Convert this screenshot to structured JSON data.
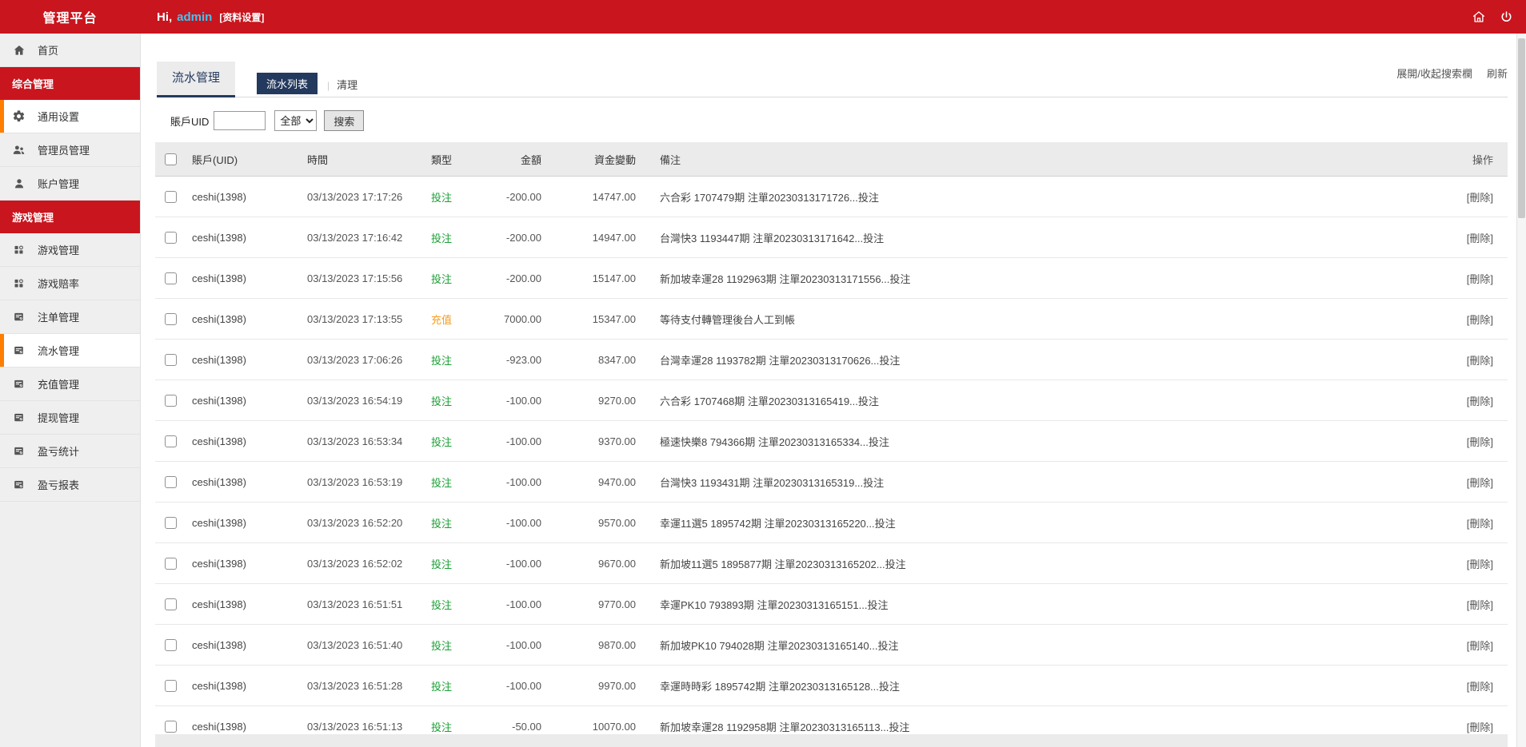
{
  "app": {
    "title": "管理平台"
  },
  "header": {
    "greeting_prefix": "Hi,",
    "greeting_name": "admin",
    "profile_link": "[资料设置]"
  },
  "sidebar": {
    "items": [
      {
        "type": "item",
        "label": "首页",
        "icon": "home",
        "active": false
      },
      {
        "type": "section",
        "label": "综合管理"
      },
      {
        "type": "item",
        "label": "通用设置",
        "icon": "gear",
        "active": true
      },
      {
        "type": "item",
        "label": "管理员管理",
        "icon": "users",
        "active": false
      },
      {
        "type": "item",
        "label": "账户管理",
        "icon": "user",
        "active": false
      },
      {
        "type": "section",
        "label": "游戏管理"
      },
      {
        "type": "item",
        "label": "游戏管理",
        "icon": "apps",
        "active": false
      },
      {
        "type": "item",
        "label": "游戏赔率",
        "icon": "apps",
        "active": false
      },
      {
        "type": "item",
        "label": "注单管理",
        "icon": "doc",
        "active": false
      },
      {
        "type": "item",
        "label": "流水管理",
        "icon": "doc",
        "active": true
      },
      {
        "type": "item",
        "label": "充值管理",
        "icon": "doc",
        "active": false
      },
      {
        "type": "item",
        "label": "提现管理",
        "icon": "doc",
        "active": false
      },
      {
        "type": "item",
        "label": "盈亏统计",
        "icon": "doc",
        "active": false
      },
      {
        "type": "item",
        "label": "盈亏报表",
        "icon": "doc",
        "active": false
      }
    ]
  },
  "main": {
    "page_title": "流水管理",
    "tabs": [
      {
        "label": "流水列表",
        "active": true
      },
      {
        "label": "清理",
        "active": false
      }
    ],
    "toolbar": {
      "toggle_search": "展開/收起搜索欄",
      "refresh": "刷新"
    },
    "search": {
      "label": "賬戶UID",
      "value": "",
      "select_value": "全部",
      "button": "搜索"
    },
    "table": {
      "headers": {
        "account": "賬戶(UID)",
        "time": "時間",
        "type": "類型",
        "amount": "金額",
        "balance": "資金變動",
        "remark": "備注",
        "action": "操作"
      },
      "action_label": "[刪除]",
      "type_colors": {
        "投注": "#1aa034",
        "充值": "#f79c1f"
      },
      "rows": [
        {
          "account": "ceshi(1398)",
          "time": "03/13/2023 17:17:26",
          "type": "投注",
          "amount": "-200.00",
          "balance": "14747.00",
          "remark": "六合彩 1707479期 注單20230313171726...投注"
        },
        {
          "account": "ceshi(1398)",
          "time": "03/13/2023 17:16:42",
          "type": "投注",
          "amount": "-200.00",
          "balance": "14947.00",
          "remark": "台灣快3 1193447期 注單20230313171642...投注"
        },
        {
          "account": "ceshi(1398)",
          "time": "03/13/2023 17:15:56",
          "type": "投注",
          "amount": "-200.00",
          "balance": "15147.00",
          "remark": "新加坡幸運28 1192963期 注單20230313171556...投注"
        },
        {
          "account": "ceshi(1398)",
          "time": "03/13/2023 17:13:55",
          "type": "充值",
          "amount": "7000.00",
          "balance": "15347.00",
          "remark": "等待支付轉管理後台人工到帳"
        },
        {
          "account": "ceshi(1398)",
          "time": "03/13/2023 17:06:26",
          "type": "投注",
          "amount": "-923.00",
          "balance": "8347.00",
          "remark": "台灣幸運28 1193782期 注單20230313170626...投注"
        },
        {
          "account": "ceshi(1398)",
          "time": "03/13/2023 16:54:19",
          "type": "投注",
          "amount": "-100.00",
          "balance": "9270.00",
          "remark": "六合彩 1707468期 注單20230313165419...投注"
        },
        {
          "account": "ceshi(1398)",
          "time": "03/13/2023 16:53:34",
          "type": "投注",
          "amount": "-100.00",
          "balance": "9370.00",
          "remark": "極速快樂8 794366期 注單20230313165334...投注"
        },
        {
          "account": "ceshi(1398)",
          "time": "03/13/2023 16:53:19",
          "type": "投注",
          "amount": "-100.00",
          "balance": "9470.00",
          "remark": "台灣快3 1193431期 注單20230313165319...投注"
        },
        {
          "account": "ceshi(1398)",
          "time": "03/13/2023 16:52:20",
          "type": "投注",
          "amount": "-100.00",
          "balance": "9570.00",
          "remark": "幸運11選5 1895742期 注單20230313165220...投注"
        },
        {
          "account": "ceshi(1398)",
          "time": "03/13/2023 16:52:02",
          "type": "投注",
          "amount": "-100.00",
          "balance": "9670.00",
          "remark": "新加坡11選5 1895877期 注單20230313165202...投注"
        },
        {
          "account": "ceshi(1398)",
          "time": "03/13/2023 16:51:51",
          "type": "投注",
          "amount": "-100.00",
          "balance": "9770.00",
          "remark": "幸運PK10 793893期 注單20230313165151...投注"
        },
        {
          "account": "ceshi(1398)",
          "time": "03/13/2023 16:51:40",
          "type": "投注",
          "amount": "-100.00",
          "balance": "9870.00",
          "remark": "新加坡PK10 794028期 注單20230313165140...投注"
        },
        {
          "account": "ceshi(1398)",
          "time": "03/13/2023 16:51:28",
          "type": "投注",
          "amount": "-100.00",
          "balance": "9970.00",
          "remark": "幸運時時彩 1895742期 注單20230313165128...投注"
        },
        {
          "account": "ceshi(1398)",
          "time": "03/13/2023 16:51:13",
          "type": "投注",
          "amount": "-50.00",
          "balance": "10070.00",
          "remark": "新加坡幸運28 1192958期 注單20230313165113...投注"
        }
      ]
    }
  },
  "colors": {
    "brand_red": "#c9151e",
    "accent_orange": "#ff7d01",
    "tab_navy": "#24395e",
    "name_cyan": "#3cc6f4",
    "bet_green": "#1aa034",
    "recharge_orange": "#f79c1f"
  }
}
